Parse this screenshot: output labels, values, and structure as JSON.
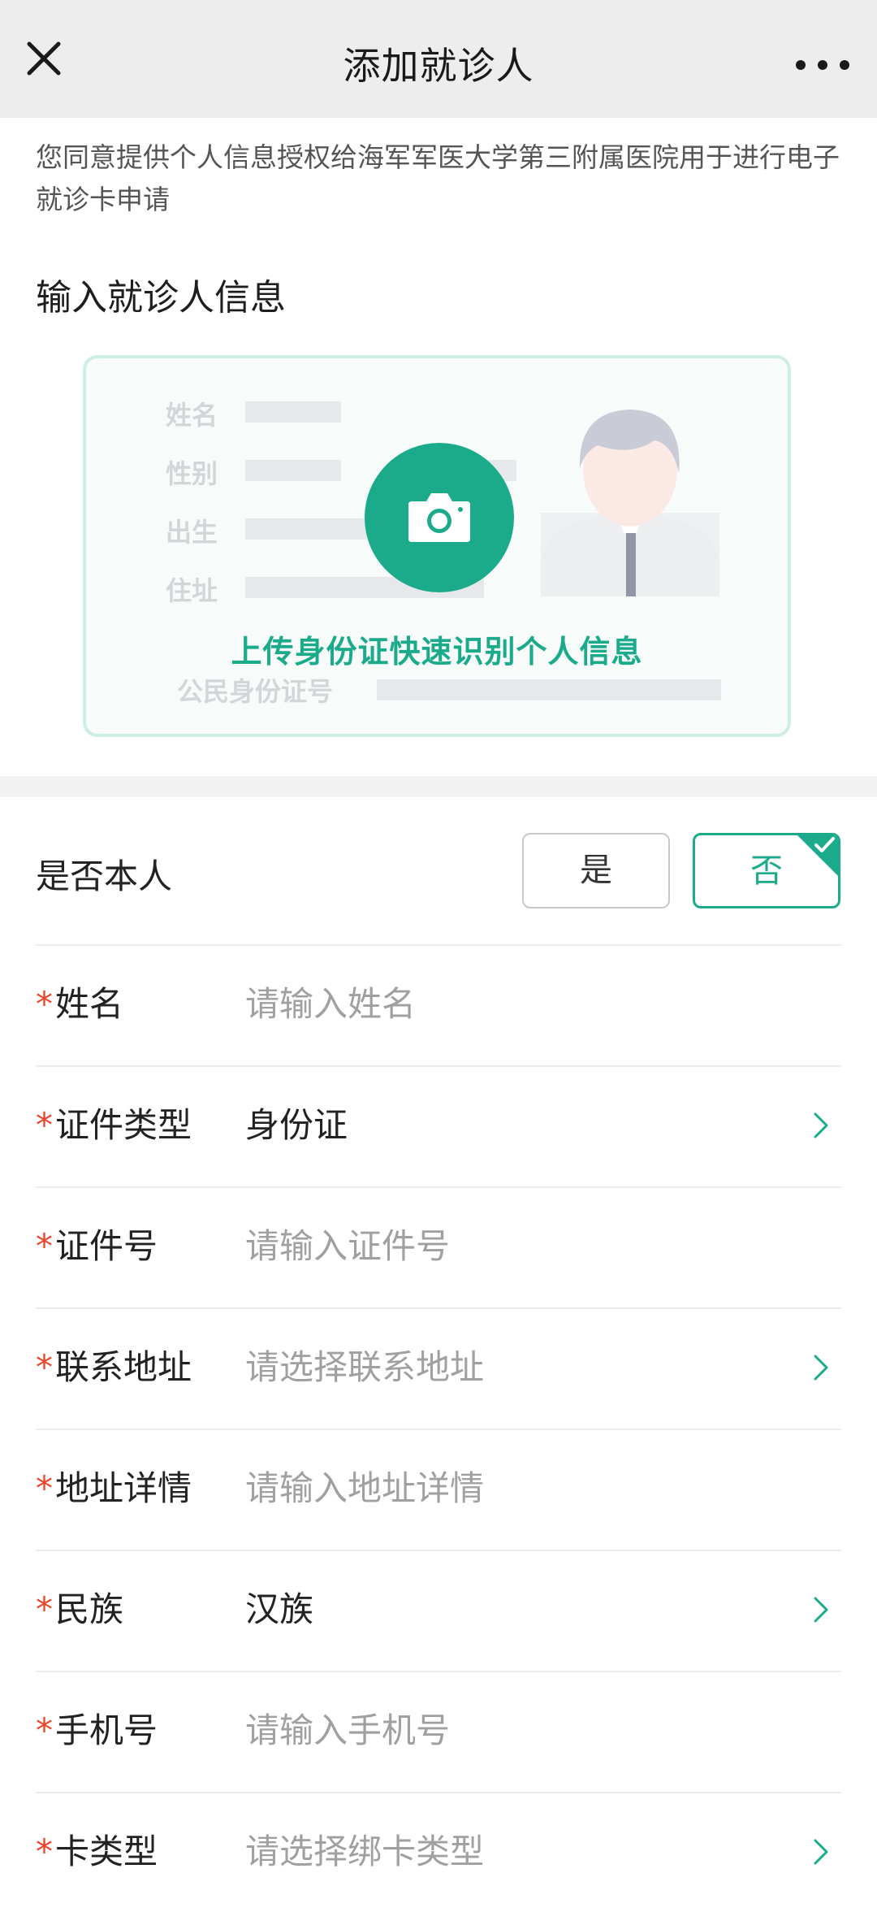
{
  "header": {
    "title": "添加就诊人"
  },
  "consent": {
    "text": "您同意提供个人信息授权给海军军医大学第三附属医院用于进行电子就诊卡申请"
  },
  "section": {
    "title": "输入就诊人信息"
  },
  "id_card": {
    "labels": {
      "name": "姓名",
      "gender": "性别",
      "birth": "出生",
      "address": "住址",
      "id_number": "公民身份证号"
    },
    "upload_text": "上传身份证快速识别个人信息"
  },
  "self_toggle": {
    "label": "是否本人",
    "yes": "是",
    "no": "否",
    "selected": "否"
  },
  "colors": {
    "accent": "#1bab8b",
    "required": "#e8472d",
    "placeholder": "#a0a0a0"
  },
  "form": {
    "rows": [
      {
        "required": "*",
        "label": "姓名",
        "value": "请输入姓名",
        "is_placeholder": true,
        "has_chevron": false
      },
      {
        "required": "*",
        "label": "证件类型",
        "value": "身份证",
        "is_placeholder": false,
        "has_chevron": true
      },
      {
        "required": "*",
        "label": "证件号",
        "value": "请输入证件号",
        "is_placeholder": true,
        "has_chevron": false
      },
      {
        "required": "*",
        "label": "联系地址",
        "value": "请选择联系地址",
        "is_placeholder": true,
        "has_chevron": true
      },
      {
        "required": "*",
        "label": "地址详情",
        "value": "请输入地址详情",
        "is_placeholder": true,
        "has_chevron": false
      },
      {
        "required": "*",
        "label": "民族",
        "value": "汉族",
        "is_placeholder": false,
        "has_chevron": true
      },
      {
        "required": "*",
        "label": "手机号",
        "value": "请输入手机号",
        "is_placeholder": true,
        "has_chevron": false
      },
      {
        "required": "*",
        "label": "卡类型",
        "value": "请选择绑卡类型",
        "is_placeholder": true,
        "has_chevron": true
      }
    ]
  }
}
